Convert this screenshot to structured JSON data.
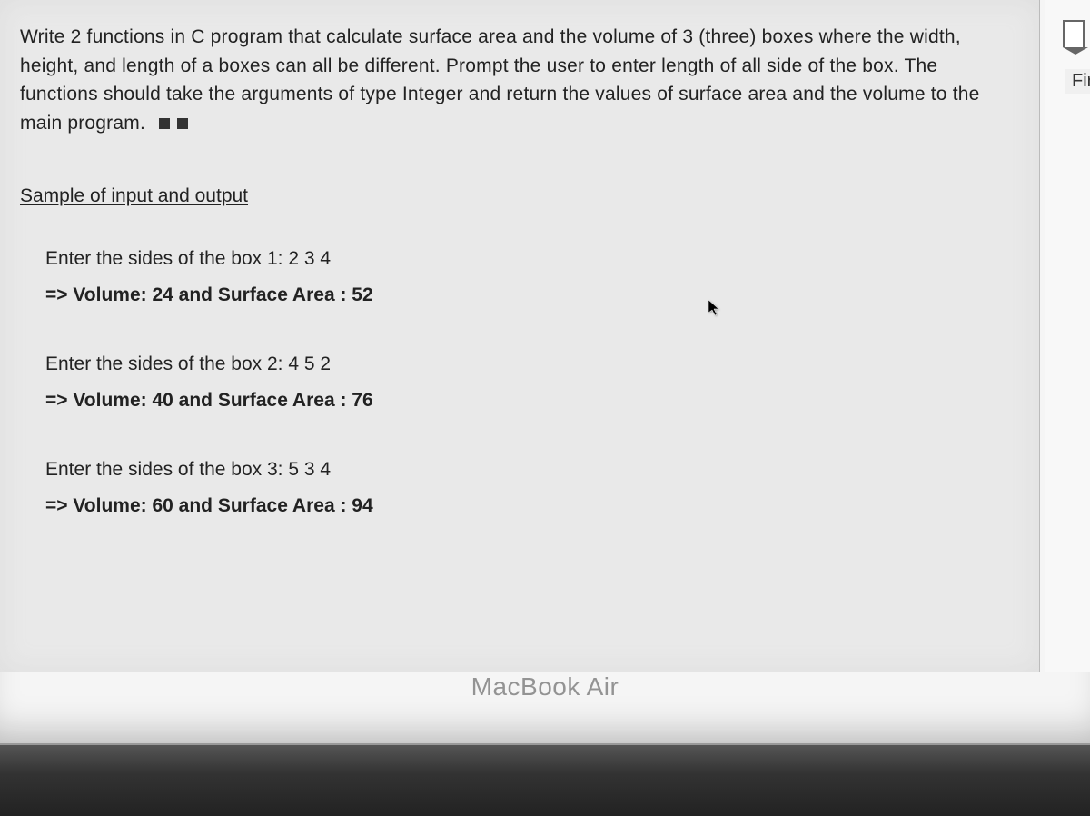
{
  "problem": {
    "text": "Write 2 functions in C program that calculate surface area and the volume of 3 (three) boxes where the width, height, and length of a boxes can all be different. Prompt the user to enter length of all side of the box. The functions should take the arguments of type Integer and return the values of surface area and the volume to the main program."
  },
  "sample_header": "Sample of input and output",
  "samples": [
    {
      "input": "Enter the sides of the box 1:   2  3  4",
      "output": "=> Volume: 24 and Surface Area : 52"
    },
    {
      "input": "Enter the sides of the box 2:   4  5  2",
      "output": "=> Volume: 40 and Surface Area : 76"
    },
    {
      "input": "Enter the sides of the box 3:   5  3  4",
      "output": "=> Volume: 60 and Surface Area : 94"
    }
  ],
  "right_panel": {
    "button_fragment": "Fir"
  },
  "device_label": "MacBook Air"
}
